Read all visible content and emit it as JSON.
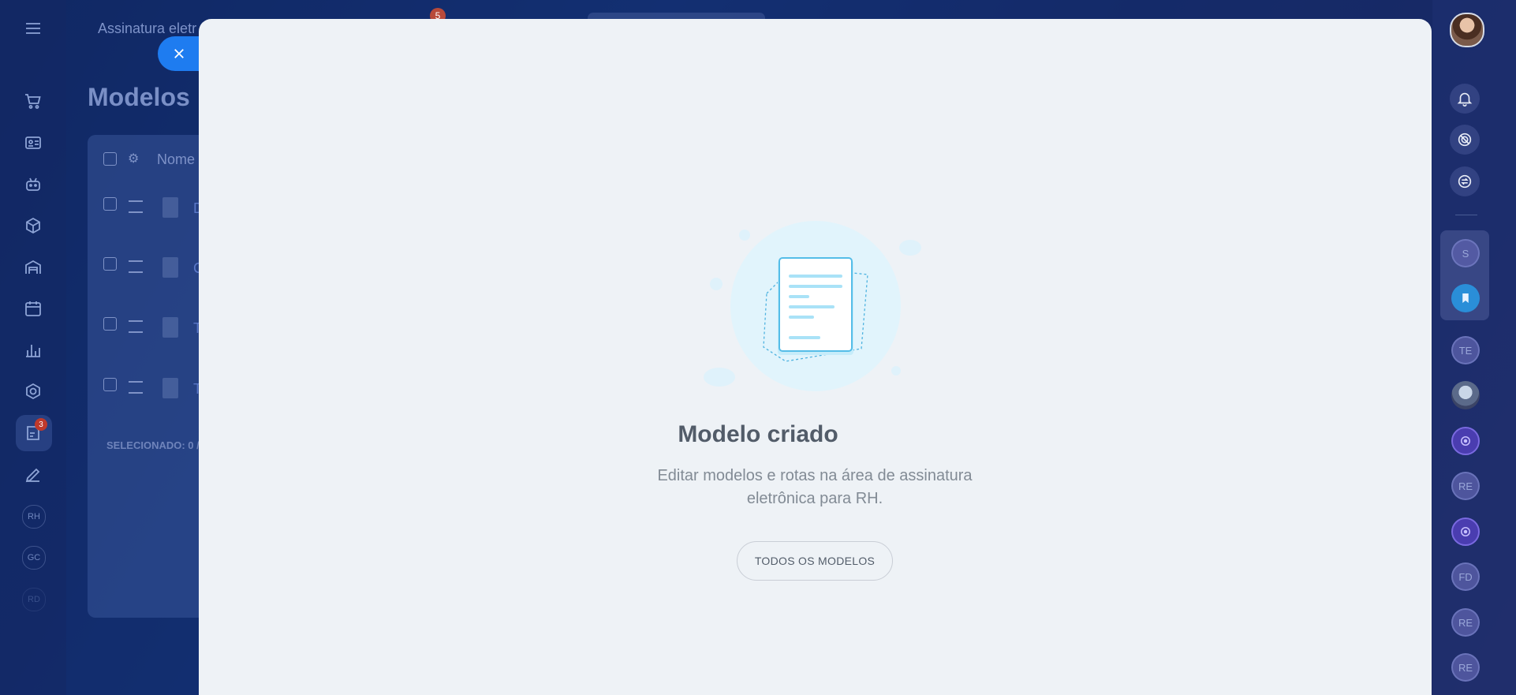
{
  "background_page": {
    "header_title": "Assinatura eletr",
    "header_badge": "5",
    "page_title": "Modelos",
    "column_header": "Nome",
    "selection_text": "SELECIONADO: 0 /",
    "row_letters": [
      "D",
      "C",
      "T",
      "T"
    ],
    "left_sidebar": {
      "active_badge": "3",
      "text_items": [
        "RH",
        "GC",
        "RD"
      ]
    }
  },
  "right_sidebar": {
    "chips": [
      "S",
      "TE",
      "RE",
      "FD",
      "RE",
      "RE"
    ]
  },
  "modal": {
    "title": "Modelo criado",
    "description": "Editar modelos e rotas na área de assinatura eletrônica para RH.",
    "button_label": "TODOS OS MODELOS"
  },
  "colors": {
    "accent": "#1e7cf0",
    "panel_bg": "#eef2f6",
    "title": "#525c69",
    "text_muted": "#828b95"
  }
}
